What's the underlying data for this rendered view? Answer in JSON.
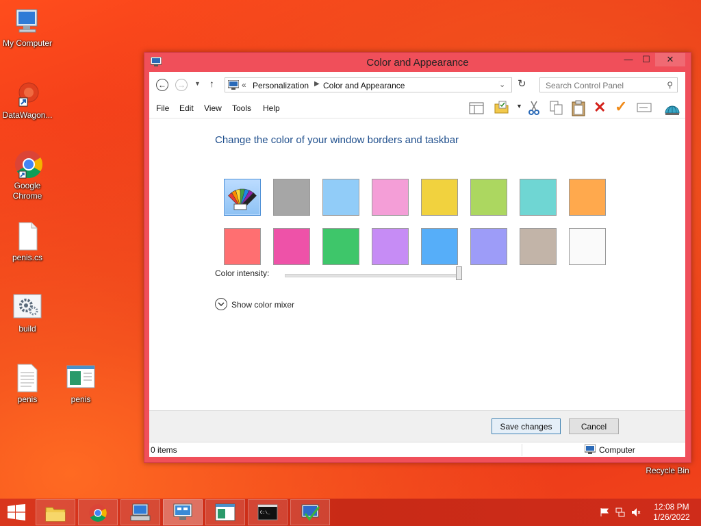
{
  "desktop": {
    "icons": [
      {
        "label": "My Computer"
      },
      {
        "label": "DataWagon..."
      },
      {
        "label": "Google Chrome"
      },
      {
        "label": "penis.cs"
      },
      {
        "label": "build"
      },
      {
        "label": "penis"
      },
      {
        "label": "penis"
      },
      {
        "label": "Recycle Bin"
      }
    ]
  },
  "window": {
    "title": "Color and Appearance",
    "controls": {
      "minimize": "—",
      "maximize": "☐",
      "close": "✕"
    },
    "address": {
      "prefix": "«",
      "crumbs": [
        "Personalization",
        "Color and Appearance"
      ]
    },
    "search": {
      "placeholder": "Search Control Panel"
    },
    "menu": [
      "File",
      "Edit",
      "View",
      "Tools",
      "Help"
    ],
    "content": {
      "heading": "Change the color of your window borders and taskbar",
      "swatches_row1": [
        "auto",
        "#a6a6a6",
        "#91ccf8",
        "#f49ed7",
        "#f1d23e",
        "#acd760",
        "#6fd6d3",
        "#ffa94d"
      ],
      "swatches_row2": [
        "#ff6f71",
        "#ee52a8",
        "#3ec66a",
        "#c68cf5",
        "#56aef9",
        "#9d9cf8",
        "#c2b4a8",
        "#fafafa"
      ],
      "intensity_label": "Color intensity:",
      "intensity_value": 1.0,
      "mixer_label": "Show color mixer"
    },
    "footer": {
      "save": "Save changes",
      "cancel": "Cancel"
    },
    "status": {
      "items": "0 items",
      "location": "Computer"
    }
  },
  "taskbar": {
    "time": "12:08 PM",
    "date": "1/26/2022"
  },
  "colors": {
    "window_border": "#f04f5a",
    "heading": "#1e4e8c",
    "taskbar": "#d9361d"
  }
}
